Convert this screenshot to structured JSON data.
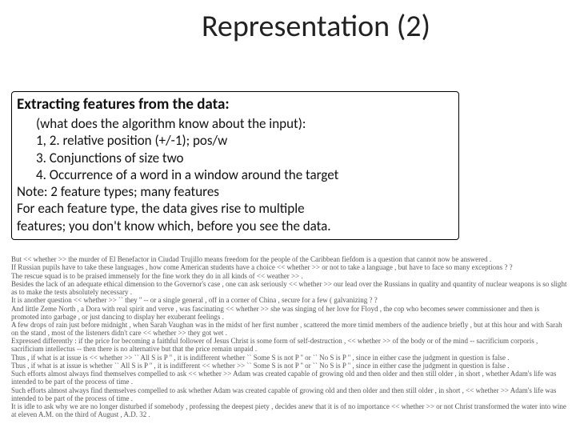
{
  "title": "Representation (2)",
  "box": {
    "heading": "Extracting features from the data:",
    "lines": [
      "(what does the algorithm know about the input):",
      "1, 2. relative position (+/-1); pos/w",
      "3. Conjunctions of size two",
      "4. Occurrence of a word in a window around the target"
    ],
    "note1": "Note: 2 feature types; many features",
    "note2a": "For each feature type, the data gives rise to multiple",
    "note2b": "features; you don't know which, before you see the data."
  },
  "corpus": [
    "But << whether >> the murder of El Benefactor in Ciudad Trujillo means freedom for the people of the Caribbean fiefdom is a question that cannot now be answered .",
    "If Russian pupils have to take these languages , how come American students have a choice << whether >> or not to take a language , but have to face so many exceptions ? ?",
    "The rescue squad is to be praised immensely for the fine work they do in all kinds of << weather >> .",
    "Besides the lack of an adequate ethical dimension to the Governor's case , one can ask seriously << whether >> our lead over the Russians in quality and quantity of nuclear weapons is so slight as to make the tests absolutely necessary .",
    "It is another question << whether >> `` they '' -- or a single general , off in a corner of China , secure for a few ( galvanizing ? ?",
    "And little Zeme North , a Dora with real spirit and verve , was fascinating << whether >> she was singing of her love for Floyd , the cop who becomes sewer commissioner and then is promoted into garbage , or just dancing to display her exuberant feelings .",
    "A few drops of rain just before midnight , when Sarah Vaughan was in the midst of her first number , scattered the more timid members of the audience briefly , but at this hour and with Sarah on the stand , most of the listeners didn't care << whether >> they got wet .",
    "Expressed differently : if the price for becoming a faithful follower of Jesus Christ is some form of self-destruction , << whether >> of the body or of the mind -- sacrificium corporis , sacrificium intellectus -- then there is no alternative but that the price remain unpaid .",
    "Thus , if what is at issue is << whether >> `` All S is P '' , it is indifferent whether `` Some S is not P '' or `` No S is P '' , since in either case the judgment in question is false .",
    "Thus , if what is at issue is whether `` All S is P '' , it is indifferent << whether >> `` Some S is not P '' or `` No S is P '' , since in either case the judgment in question is false .",
    "Such efforts almost always find themselves compelled to ask << whether >> Adam was created capable of growing old and then older and then still older , in short , whether Adam's life was intended to be part of the process of time .",
    "Such efforts almost always find themselves compelled to ask whether Adam was created capable of growing old and then older and then still older , in short , << whether >> Adam's life was intended to be part of the process of time .",
    "It is idle to ask why we are no longer disturbed if somebody , professing the deepest piety , decides anew that it is of no importance << whether >> or not Christ transformed the water into wine at eleven A.M. on the third of August , A.D. 32 ."
  ]
}
